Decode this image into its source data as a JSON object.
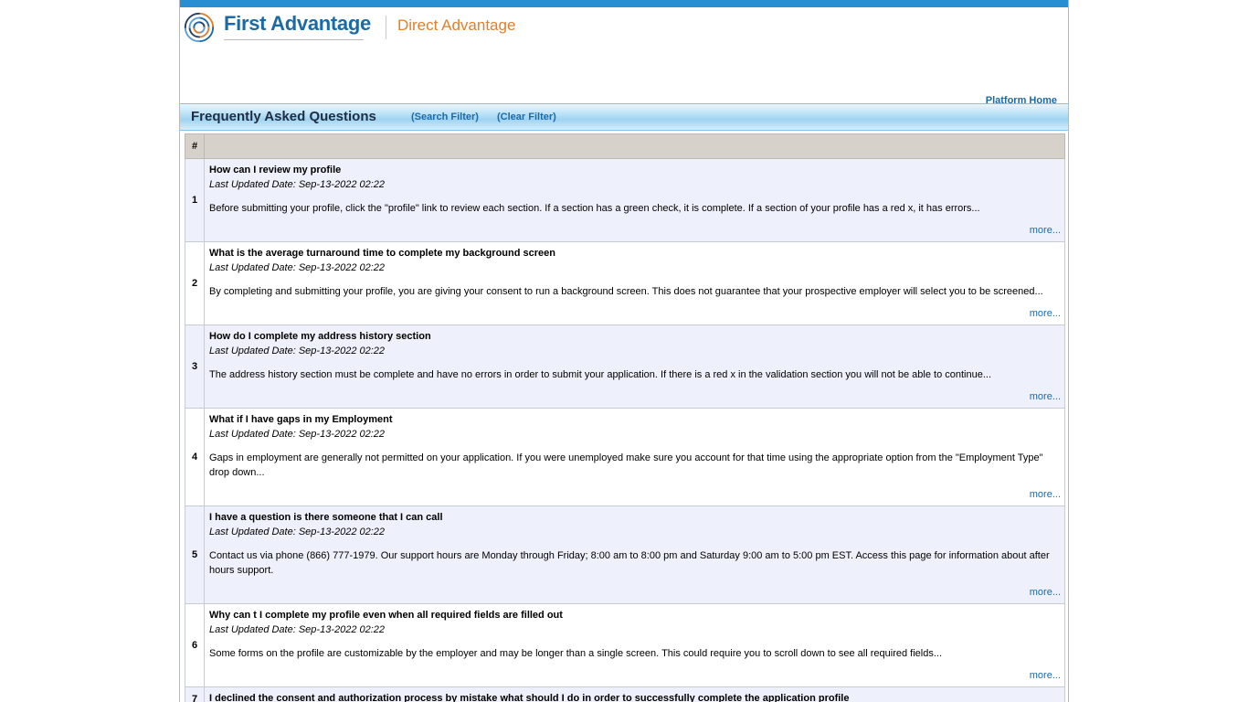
{
  "header": {
    "brand": "First Advantage",
    "product": "Direct Advantage",
    "platform_home": "Platform Home"
  },
  "titlebar": {
    "title": "Frequently Asked Questions",
    "search_filter": "(Search Filter)",
    "clear_filter": "(Clear Filter)"
  },
  "table": {
    "col_num": "#",
    "col_content": ""
  },
  "faq": [
    {
      "num": "1",
      "question": "How can I review my profile",
      "date": "Last Updated Date:  Sep-13-2022 02:22",
      "body": "Before submitting your profile, click the \"profile\" link to review each section. If a section has a green check, it is complete. If a section of your profile has a red x, it has errors...",
      "more": "more..."
    },
    {
      "num": "2",
      "question": "What is the average turnaround time to complete my background screen",
      "date": "Last Updated Date:  Sep-13-2022 02:22",
      "body": "By completing and submitting your profile, you are giving your consent to run a background screen. This does not guarantee that your prospective employer will select you to be screened...",
      "more": "more..."
    },
    {
      "num": "3",
      "question": "How do I complete my address history section",
      "date": "Last Updated Date:  Sep-13-2022 02:22",
      "body": "The address history section must be complete and have no errors in order to submit your application. If there is a red x in the validation section you will not be able to continue...",
      "more": "more..."
    },
    {
      "num": "4",
      "question": "What if I have gaps in my Employment",
      "date": "Last Updated Date:  Sep-13-2022 02:22",
      "body": "Gaps in employment are generally not permitted on your application. If you were unemployed make sure you account for that time using the appropriate option from the \"Employment Type\" drop down...",
      "more": "more..."
    },
    {
      "num": "5",
      "question": "I have a question is there someone that I can call",
      "date": "Last Updated Date:  Sep-13-2022 02:22",
      "body": "Contact us via phone (866) 777-1979. Our support hours are Monday through Friday; 8:00 am to 8:00 pm and Saturday 9:00 am to 5:00 pm EST. Access this page for information about after hours support.",
      "more": "more..."
    },
    {
      "num": "6",
      "question": "Why can t I complete my profile even when all required fields are filled out",
      "date": "Last Updated Date:  Sep-13-2022 02:22",
      "body": "Some forms on the profile are customizable by the employer and may be longer than a single screen. This could require you to scroll down to see all required fields...",
      "more": "more..."
    },
    {
      "num": "7",
      "question": "I declined the consent and authorization process by mistake what should I do in order to successfully complete the application profile",
      "date": "",
      "body": "",
      "more": ""
    }
  ]
}
